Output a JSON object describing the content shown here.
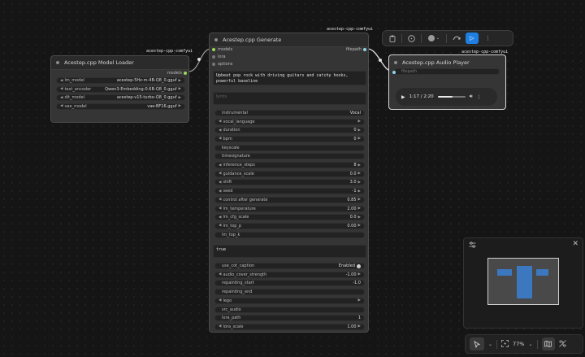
{
  "model_loader": {
    "badge": "acestep-cpp-comfyui",
    "title": "Acestep.cpp Model Loader",
    "output_label": "models",
    "widgets": [
      {
        "label": "lm_model",
        "value": "acestep-5Hz-m-4B-Q8_0.gguf"
      },
      {
        "label": "text_encoder",
        "value": "Qwen3-Embedding-0.6B-Q8_0.gguf"
      },
      {
        "label": "dit_model",
        "value": "acestep-v15-turbo-Q8_0.gguf"
      },
      {
        "label": "vae_model",
        "value": "vae-BF16.gguf"
      }
    ]
  },
  "generate": {
    "badge": "acestep-cpp-comfyui",
    "title": "Acestep.cpp Generate",
    "inputs": [
      "models",
      "lora",
      "options"
    ],
    "output_label": "filepath",
    "prompt_text": "Upbeat pop rock with driving guitars and catchy hooks, powerful baseline",
    "lyrics_placeholder": "lyrics",
    "toggle_instrumental": {
      "label": "instrumental",
      "value": "Vocal"
    },
    "widgets": [
      {
        "label": "vocal_language",
        "value": "",
        "arrows": true
      },
      {
        "label": "duration",
        "value": "0",
        "arrows": true
      },
      {
        "label": "bpm",
        "value": "0",
        "arrows": true
      },
      {
        "label": "keyscale",
        "value": "",
        "arrows": false
      },
      {
        "label": "timesignature",
        "value": "",
        "arrows": false
      },
      {
        "label": "inference_steps",
        "value": "8",
        "arrows": true
      },
      {
        "label": "guidance_scale",
        "value": "0.0",
        "arrows": true
      },
      {
        "label": "shift",
        "value": "3.0",
        "arrows": true
      },
      {
        "label": "seed",
        "value": "-1",
        "arrows": true
      },
      {
        "label": "control after generate",
        "value": "0.85",
        "arrows": true
      },
      {
        "label": "lm_temperature",
        "value": "2.00",
        "arrows": true
      },
      {
        "label": "lm_cfg_scale",
        "value": "0.0",
        "arrows": true
      },
      {
        "label": "lm_top_p",
        "value": "0.00",
        "arrows": true
      },
      {
        "label": "lm_top_k",
        "value": "",
        "arrows": false
      }
    ],
    "true_text": "true",
    "widgets2": [
      {
        "label": "use_cot_caption",
        "value": "Enabled",
        "toggle": true
      },
      {
        "label": "audio_cover_strength",
        "value": "-1.00",
        "arrows": true
      },
      {
        "label": "repainting_start",
        "value": "-1.0",
        "arrows": false
      },
      {
        "label": "repainting_end",
        "value": "",
        "arrows": false
      },
      {
        "label": "lego",
        "value": "",
        "arrows": true
      },
      {
        "label": "src_audio",
        "value": "",
        "arrows": false
      },
      {
        "label": "lora_path",
        "value": "1",
        "arrows": false
      },
      {
        "label": "lora_scale",
        "value": "1.00",
        "arrows": true
      }
    ]
  },
  "audio_player": {
    "badge": "acestep-cpp-comfyui",
    "title": "Acestep.cpp Audio Player",
    "input_label": "filepath",
    "time": "1:17 / 2:20",
    "progress": 0.55
  },
  "toolbar": {
    "icons": [
      "clipboard-icon",
      "info-icon",
      "color-circle-icon",
      "chevron-down-icon",
      "bypass-icon",
      "run-icon",
      "more-icon"
    ]
  },
  "zoom": {
    "value": "77%"
  },
  "colors": {
    "model_slot": "#9bd85a",
    "string_slot": "#8fd4e8",
    "run_button": "#1e7fe0",
    "minimap_node": "#3c78c0"
  }
}
